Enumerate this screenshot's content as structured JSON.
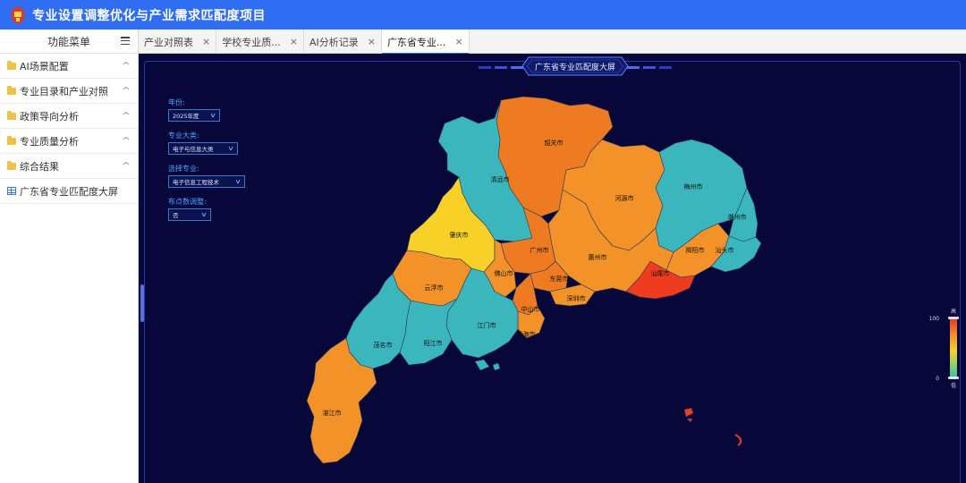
{
  "app": {
    "title": "专业设置调整优化与产业需求匹配度项目"
  },
  "sidebar": {
    "header": "功能菜单",
    "items": [
      {
        "label": "AI场景配置",
        "icon": "folder-icon"
      },
      {
        "label": "专业目录和产业对照",
        "icon": "folder-icon"
      },
      {
        "label": "政策导向分析",
        "icon": "folder-icon"
      },
      {
        "label": "专业质量分析",
        "icon": "folder-icon"
      },
      {
        "label": "综合结果",
        "icon": "folder-icon"
      },
      {
        "label": "广东省专业匹配度大屏",
        "icon": "grid-icon"
      }
    ]
  },
  "tabs": [
    {
      "label": "产业对照表",
      "close": "×"
    },
    {
      "label": "学校专业质...",
      "close": "×"
    },
    {
      "label": "AI分析记录",
      "close": "×"
    },
    {
      "label": "广东省专业...",
      "close": "×"
    }
  ],
  "dashboard": {
    "title": "广东省专业匹配度大屏",
    "filters": {
      "year_label": "年份:",
      "year_value": "2025年度",
      "category_label": "专业大类:",
      "category_value": "电子与信息大类",
      "major_label": "选择专业:",
      "major_value": "电子信息工程技术",
      "points_label": "布点数调整:",
      "points_value": "否"
    },
    "legend": {
      "high": "高",
      "low": "低",
      "max": "100",
      "min": "0"
    },
    "cities": {
      "shaoguan": "韶关市",
      "qingyuan": "清远市",
      "heyuan": "河源市",
      "meizhou": "梅州市",
      "chaozhou": "潮州市",
      "zhaoqing": "肇庆市",
      "guangzhou": "广州市",
      "huizhou": "惠州市",
      "jieyang": "揭阳市",
      "shantou": "汕头市",
      "shanwei": "汕尾市",
      "foshan": "佛山市",
      "dongguan": "东莞市",
      "yunfu": "云浮市",
      "shenzhen": "深圳市",
      "zhongshan": "中山市",
      "jiangmen": "江门市",
      "maoming": "茂名市",
      "yangjiang": "阳江市",
      "zhuhai": "珠海市",
      "zhanjiang": "湛江市"
    },
    "colors": {
      "teal": "#3bb6bd",
      "orange": "#f39228",
      "dark_orange": "#ee7a21",
      "yellow": "#f8d128",
      "red": "#ef3b1e",
      "background": "#08073a"
    }
  }
}
